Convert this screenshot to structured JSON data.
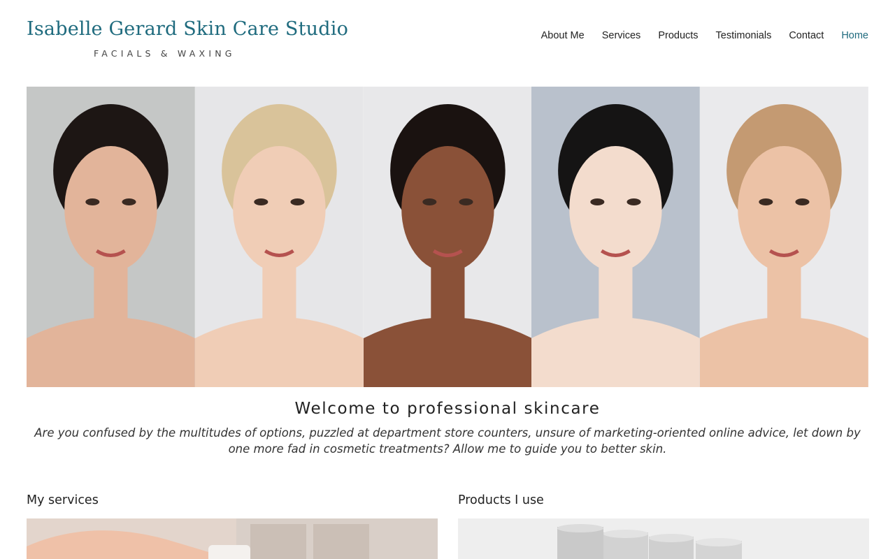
{
  "brand": {
    "title": "Isabelle Gerard Skin Care Studio",
    "tagline": "FACIALS & WAXING",
    "color": "#1f6b7e"
  },
  "nav": {
    "items": [
      {
        "label": "About Me"
      },
      {
        "label": "Services"
      },
      {
        "label": "Products"
      },
      {
        "label": "Testimonials"
      },
      {
        "label": "Contact"
      },
      {
        "label": "Home",
        "active": true
      }
    ]
  },
  "hero": {
    "portraits": [
      {
        "bg": "#c5c7c6",
        "skin": "#e2b49a",
        "hair": "#1d1614"
      },
      {
        "bg": "#e6e6e8",
        "skin": "#f0cdb6",
        "hair": "#d9c39a"
      },
      {
        "bg": "#e8e8ea",
        "skin": "#8a5138",
        "hair": "#1a1210"
      },
      {
        "bg": "#b9c1cc",
        "skin": "#f3dccd",
        "hair": "#151414"
      },
      {
        "bg": "#eaeaec",
        "skin": "#ecc2a6",
        "hair": "#c49a72"
      }
    ]
  },
  "welcome": {
    "heading": "Welcome to professional skincare",
    "body": "Are you confused by the multitudes of options, puzzled at department store counters, unsure of marketing-oriented online advice, let down by one more fad in cosmetic treatments? Allow me to guide you to better skin."
  },
  "sections": {
    "services": {
      "heading": "My services"
    },
    "products": {
      "heading": "Products I use"
    }
  }
}
